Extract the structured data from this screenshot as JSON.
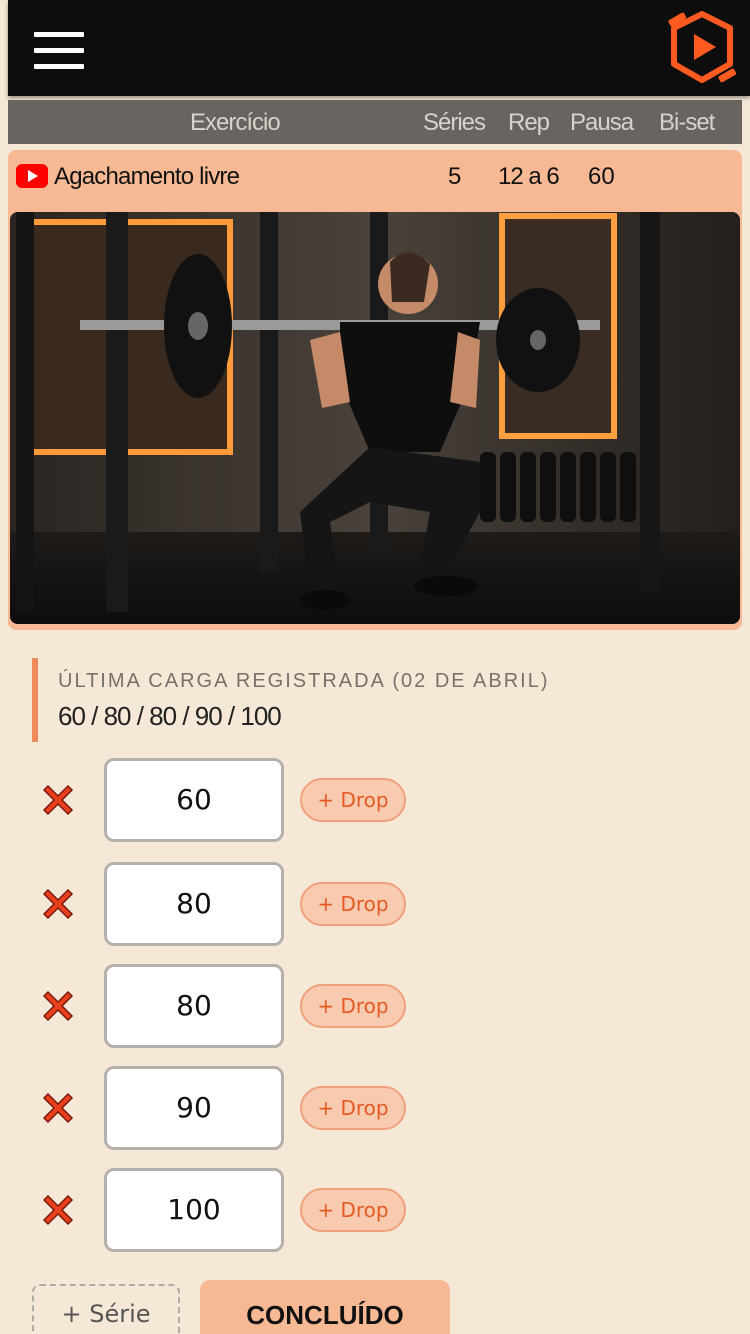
{
  "topbar": {
    "menu_icon": "hamburger-menu-icon",
    "logo_icon": "app-logo-icon",
    "accent_color": "#ff5a1f"
  },
  "table_header": {
    "exercise": "Exercício",
    "series": "Séries",
    "rep": "Rep",
    "pause": "Pausa",
    "biset": "Bi-set"
  },
  "exercise": {
    "video_icon": "youtube-icon",
    "name": "Agachamento livre",
    "series": "5",
    "rep": "12 a 6",
    "pause": "60",
    "biset": ""
  },
  "last_load": {
    "title": "ÚLTIMA CARGA REGISTRADA (02 DE ABRIL)",
    "values": "60 / 80 / 80 / 90 / 100"
  },
  "sets": [
    {
      "load": "60",
      "drop_label": "+ Drop",
      "remove_icon": "close-x-icon"
    },
    {
      "load": "80",
      "drop_label": "+ Drop",
      "remove_icon": "close-x-icon"
    },
    {
      "load": "80",
      "drop_label": "+ Drop",
      "remove_icon": "close-x-icon"
    },
    {
      "load": "90",
      "drop_label": "+ Drop",
      "remove_icon": "close-x-icon"
    },
    {
      "load": "100",
      "drop_label": "+ Drop",
      "remove_icon": "close-x-icon"
    }
  ],
  "actions": {
    "add_serie": "+ Série",
    "done": "CONCLUÍDO"
  },
  "colors": {
    "background": "#f5e8d6",
    "card": "#f6b994",
    "header": "#686460",
    "remove": "#e8401c"
  }
}
